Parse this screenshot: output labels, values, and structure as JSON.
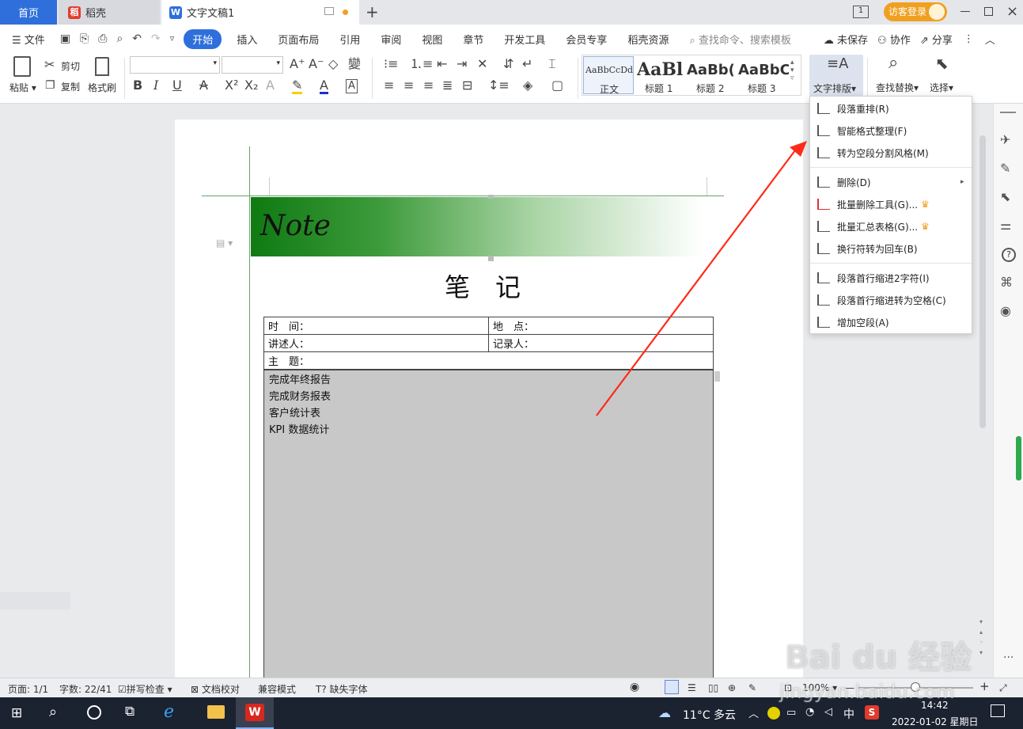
{
  "tabs": {
    "home": "首页",
    "daoke": "稻壳",
    "doc": "文字文稿1",
    "login": "访客登录"
  },
  "menu": {
    "file": "文件",
    "items": [
      "开始",
      "插入",
      "页面布局",
      "引用",
      "审阅",
      "视图",
      "章节",
      "开发工具",
      "会员专享",
      "稻壳资源"
    ],
    "search_placeholder": "查找命令、搜索模板",
    "unsaved": "未保存",
    "collab": "协作",
    "share": "分享"
  },
  "ribbon": {
    "paste": "粘贴",
    "cut": "剪切",
    "copy": "复制",
    "format_painter": "格式刷",
    "styles": [
      {
        "preview": "AaBbCcDd",
        "name": "正文"
      },
      {
        "preview": "AaBl",
        "name": "标题 1"
      },
      {
        "preview": "AaBb(",
        "name": "标题 2"
      },
      {
        "preview": "AaBbC",
        "name": "标题 3"
      }
    ],
    "text_layout": "文字排版",
    "find_replace": "查找替换",
    "select": "选择"
  },
  "dropdown": {
    "items": [
      {
        "label": "段落重排(R)"
      },
      {
        "label": "智能格式整理(F)"
      },
      {
        "label": "转为空段分割风格(M)"
      },
      {
        "label": "删除(D)",
        "submenu": true
      },
      {
        "label": "批量删除工具(G)...",
        "crown": true
      },
      {
        "label": "批量汇总表格(G)...",
        "crown": true
      },
      {
        "label": "换行符转为回车(B)"
      },
      {
        "label": "段落首行缩进2字符(I)"
      },
      {
        "label": "段落首行缩进转为空格(C)"
      },
      {
        "label": "增加空段(A)"
      }
    ]
  },
  "document": {
    "banner": "Note",
    "title": "笔　记",
    "fields": {
      "time": "时　间：",
      "place": "地　点：",
      "speaker": "讲述人：",
      "recorder": "记录人：",
      "subject": "主　题："
    },
    "lines": [
      "完成年终报告",
      "完成财务报表",
      "客户统计表",
      "KPI 数据统计"
    ]
  },
  "status": {
    "page": "页面: 1/1",
    "words": "字数: 22/41",
    "spell": "拼写检查",
    "proof": "文档校对",
    "compat": "兼容模式",
    "missing_font": "缺失字体",
    "zoom": "100%"
  },
  "taskbar": {
    "weather": "11°C  多云",
    "ime": "中",
    "time": "14:42",
    "date": "2022-01-02 星期日"
  },
  "watermark": {
    "brand": "Bai du 经验",
    "url": "jingyan.baidu.com"
  },
  "colors": {
    "accent": "#2f6fdc",
    "banner_green": "#0f7a12",
    "table_fill": "#c8c8c8",
    "arrow": "#ff2a1a"
  }
}
